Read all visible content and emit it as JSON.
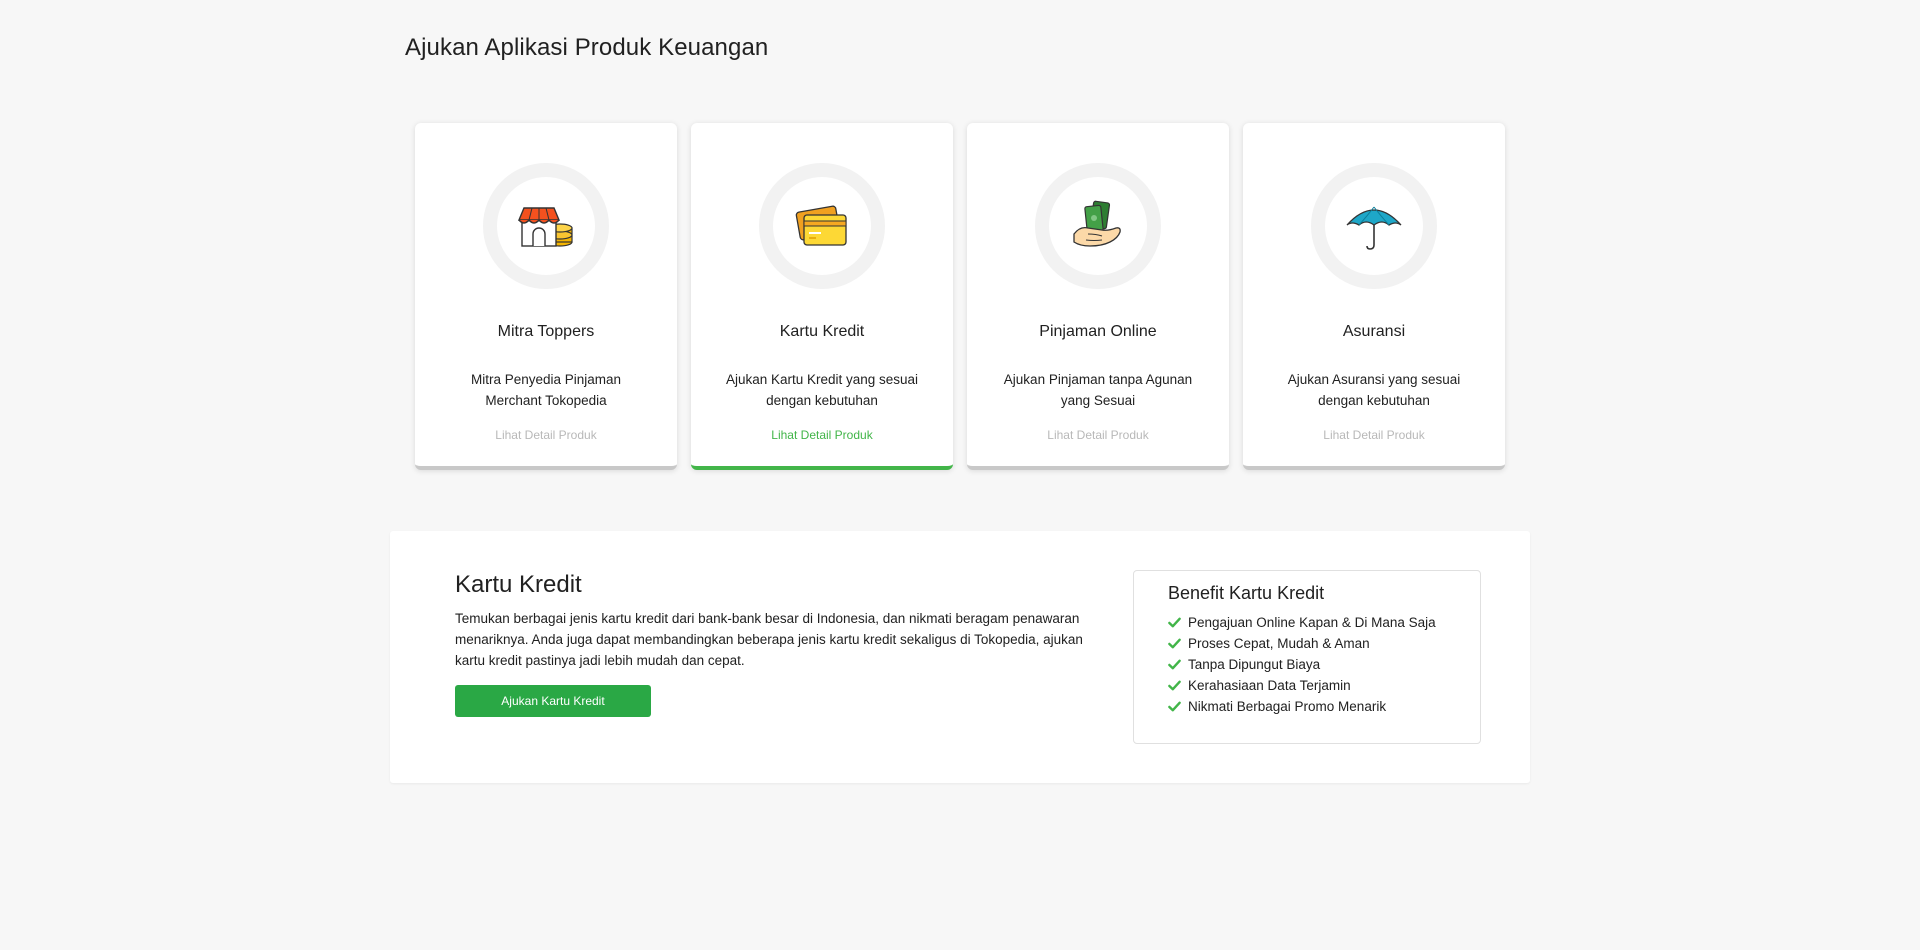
{
  "page": {
    "title": "Ajukan Aplikasi Produk Keuangan"
  },
  "cards": [
    {
      "title": "Mitra Toppers",
      "description": "Mitra Penyedia Pinjaman Merchant Tokopedia",
      "link": "Lihat Detail Produk",
      "icon": "store-coins-icon",
      "active": false
    },
    {
      "title": "Kartu Kredit",
      "description": "Ajukan Kartu Kredit yang sesuai dengan kebutuhan",
      "link": "Lihat Detail Produk",
      "icon": "credit-card-icon",
      "active": true
    },
    {
      "title": "Pinjaman Online",
      "description": "Ajukan Pinjaman tanpa Agunan yang Sesuai",
      "link": "Lihat Detail Produk",
      "icon": "hand-cash-icon",
      "active": false
    },
    {
      "title": "Asuransi",
      "description": "Ajukan Asuransi yang sesuai dengan kebutuhan",
      "link": "Lihat Detail Produk",
      "icon": "umbrella-icon",
      "active": false
    }
  ],
  "detail": {
    "title": "Kartu Kredit",
    "text": "Temukan berbagai jenis kartu kredit dari bank-bank besar di Indonesia, dan nikmati beragam penawaran menariknya. Anda juga dapat membandingkan beberapa jenis kartu kredit sekaligus di Tokopedia, ajukan kartu kredit pastinya jadi lebih mudah dan cepat.",
    "button": "Ajukan Kartu Kredit",
    "benefit": {
      "title": "Benefit Kartu Kredit",
      "items": [
        "Pengajuan Online Kapan & Di Mana Saja",
        "Proses Cepat, Mudah & Aman",
        "Tanpa Dipungut Biaya",
        "Kerahasiaan Data Terjamin",
        "Nikmati Berbagai Promo Menarik"
      ]
    }
  },
  "colors": {
    "accent": "#42b549",
    "button": "#2aa845",
    "background": "#f7f7f7"
  }
}
